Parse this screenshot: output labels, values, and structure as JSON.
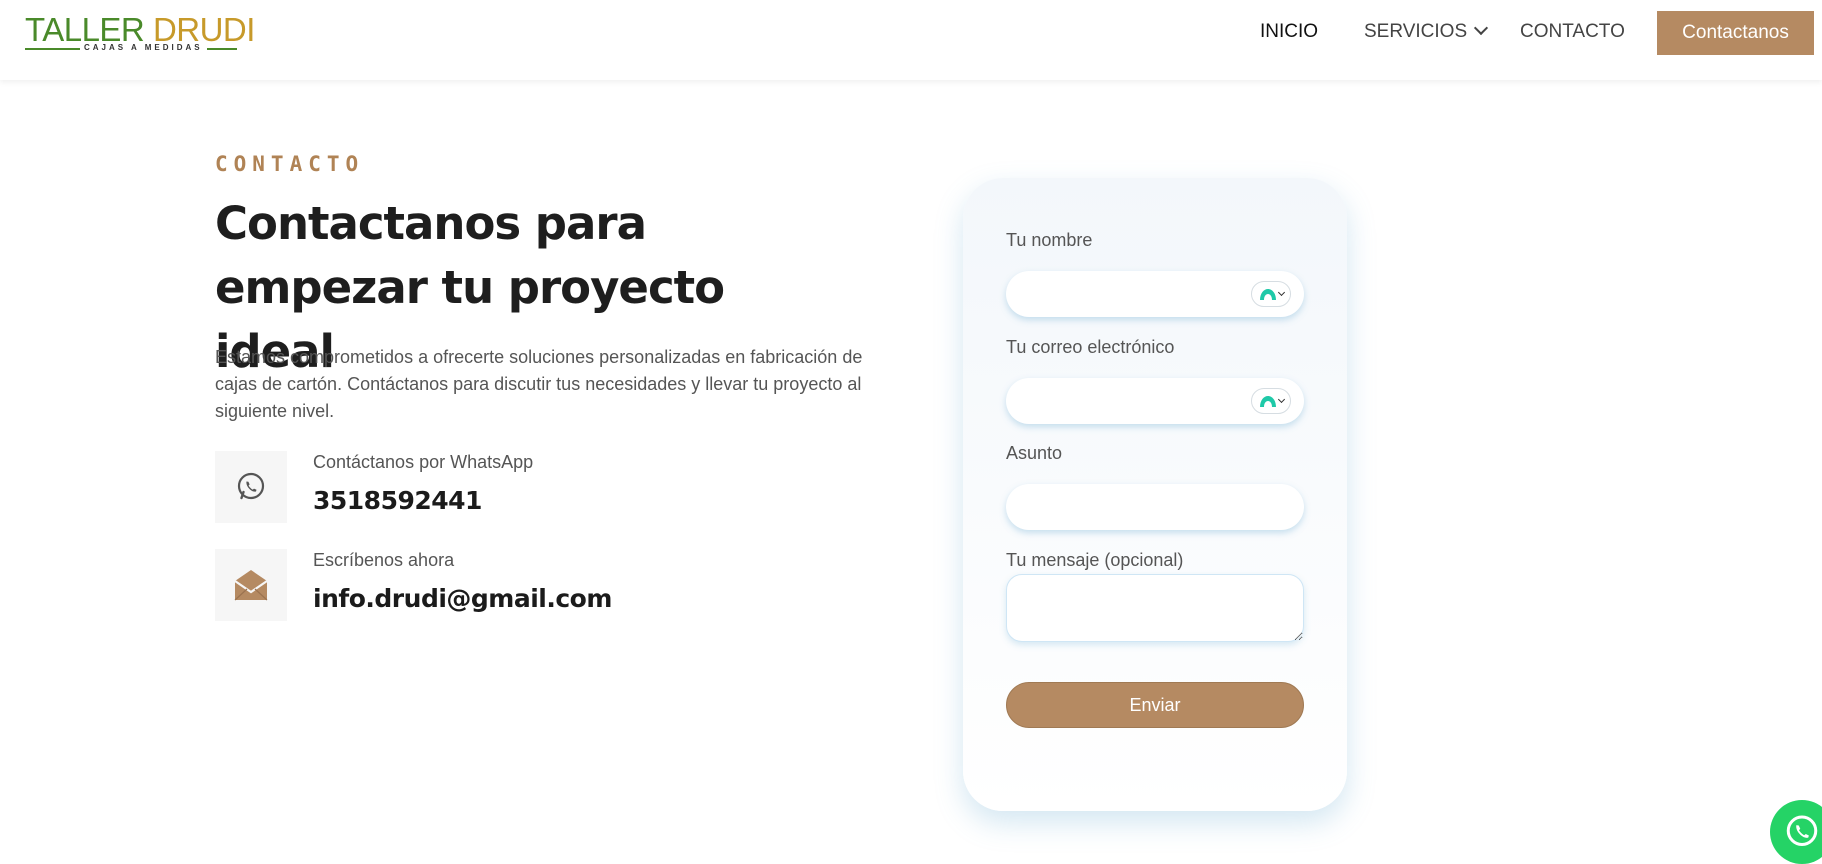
{
  "header": {
    "logo": {
      "title_part1": "TALLER ",
      "title_part2": "DRUDI",
      "subtitle": "CAJAS A MEDIDAS"
    },
    "nav": [
      {
        "label": "INICIO"
      },
      {
        "label": "SERVICIOS"
      },
      {
        "label": "CONTACTO"
      }
    ],
    "cta_label": "Contactanos"
  },
  "intro": {
    "eyebrow": "CONTACTO",
    "headline": "Contactanos para empezar tu proyecto ideal",
    "description": "Estamos comprometidos a ofrecerte soluciones personalizadas en fabricación de cajas de cartón. Contáctanos para discutir tus necesidades y llevar tu proyecto al siguiente nivel."
  },
  "contacts": [
    {
      "label": "Contáctanos por WhatsApp",
      "value": "3518592441",
      "icon": "whatsapp-icon"
    },
    {
      "label": "Escríbenos ahora",
      "value": "info.drudi@gmail.com",
      "icon": "envelope-open-icon"
    }
  ],
  "form": {
    "name_label": "Tu nombre",
    "name_value": "",
    "email_label": "Tu correo electrónico",
    "email_value": "",
    "subject_label": "Asunto",
    "subject_value": "",
    "message_label": "Tu mensaje (opcional)",
    "message_value": "",
    "submit_label": "Enviar"
  },
  "colors": {
    "accent": "#b58a62",
    "logo_green": "#4a8a2a",
    "logo_gold": "#c79a2a",
    "whatsapp_green": "#25d366",
    "password_manager_teal": "#1fc9a8"
  }
}
